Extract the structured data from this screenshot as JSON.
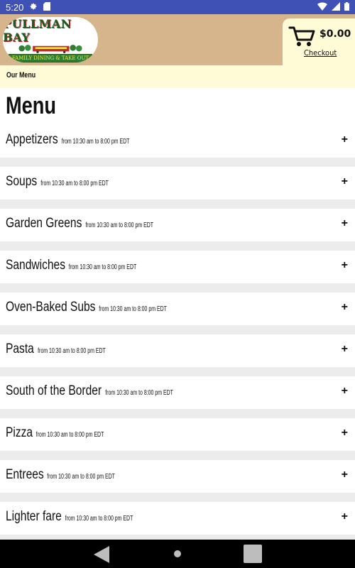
{
  "status_bar": {
    "time": "5:20",
    "icons": [
      "gear-icon",
      "sd-card-icon",
      "wifi-icon",
      "signal-icon",
      "battery-icon"
    ]
  },
  "header": {
    "logo": {
      "title": "PULLMAN BAY",
      "subtitle": "FAMILY DINING & TAKE OUT"
    },
    "cart": {
      "total": "$0.00",
      "checkout_label": "Checkout"
    }
  },
  "breadcrumb": {
    "label": "Our Menu"
  },
  "main": {
    "title": "Menu",
    "categories": [
      {
        "name": "Appetizers",
        "hours": "from 10:30 am to 8:00 pm EDT",
        "expand": "+"
      },
      {
        "name": "Soups",
        "hours": "from 10:30 am to 8:00 pm EDT",
        "expand": "+"
      },
      {
        "name": "Garden Greens",
        "hours": "from 10:30 am to 8:00 pm EDT",
        "expand": "+"
      },
      {
        "name": "Sandwiches",
        "hours": "from 10:30 am to 8:00 pm EDT",
        "expand": "+"
      },
      {
        "name": "Oven-Baked Subs",
        "hours": "from 10:30 am to 8:00 pm EDT",
        "expand": "+"
      },
      {
        "name": "Pasta",
        "hours": "from 10:30 am to 8:00 pm EDT",
        "expand": "+"
      },
      {
        "name": "South of the Border",
        "hours": "from 10:30 am to 8:00 pm EDT",
        "expand": "+"
      },
      {
        "name": "Pizza",
        "hours": "from 10:30 am to 8:00 pm EDT",
        "expand": "+"
      },
      {
        "name": "Entrees",
        "hours": "from 10:30 am to 8:00 pm EDT",
        "expand": "+"
      },
      {
        "name": "Lighter fare",
        "hours": "from 10:30 am to 8:00 pm EDT",
        "expand": "+"
      }
    ]
  },
  "colors": {
    "status_bar": "#3f51b5",
    "header_bg": "#d6b58c",
    "cream": "#fffbd6",
    "separator": "#ececec"
  },
  "nav_bar": {
    "icons": [
      "back-icon",
      "home-icon",
      "recents-icon"
    ]
  }
}
